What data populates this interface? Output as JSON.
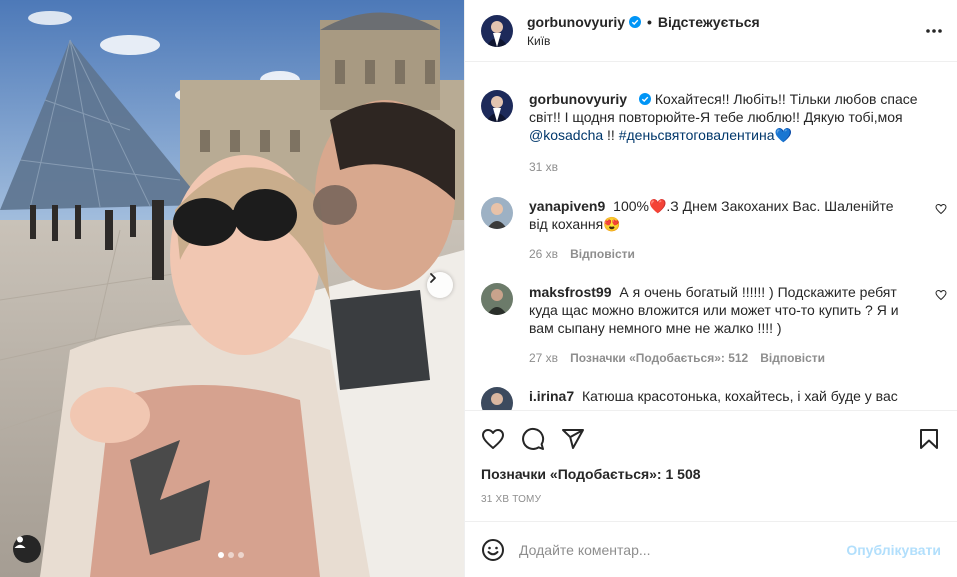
{
  "post": {
    "author": "gorbunovyuriy",
    "follow_status": "Відстежується",
    "separator": "•",
    "location": "Київ",
    "caption": {
      "username": "gorbunovyuriy",
      "text": "Кохайтеся!! Любіть!! Тільки любов спасе світ!! І щодня повторюйте-Я тебе люблю!! Дякую тобі,моя ",
      "mention": "@kosadcha",
      "text_after": " !! ",
      "hashtag": "#деньсвятоговалентина",
      "emoji": "💙",
      "time": "31 хв"
    },
    "comments": [
      {
        "username": "yanapiven9",
        "text": "100%❤️.З Днем Закоханих Вас. Шаленійте від кохання😍",
        "time": "26 хв",
        "reply": "Відповісти"
      },
      {
        "username": "maksfrost99",
        "text": "А я очень богатый !!!!!! ) Подскажите ребят куда щас можно вложится или может что-то купить ? Я и вам сыпану немного мне не жалко !!!! )",
        "time": "27 хв",
        "likes": "Позначки «Подобається»: 512",
        "reply": "Відповісти"
      },
      {
        "username": "i.irina7",
        "text": "Катюша красотонька, кохайтесь, і хай буде у вас ще"
      }
    ],
    "likes_total": "Позначки «Подобається»: 1 508",
    "timestamp": "31 хв тому",
    "comment_placeholder": "Додайте коментар...",
    "publish_label": "Опублікувати",
    "carousel": {
      "slides": 3,
      "active": 1
    }
  },
  "colors": {
    "verified": "#0095f6",
    "link": "#00376b",
    "muted": "#8e8e8e",
    "publish_disabled": "#b2dffc",
    "heart_red": "#ed4956"
  }
}
